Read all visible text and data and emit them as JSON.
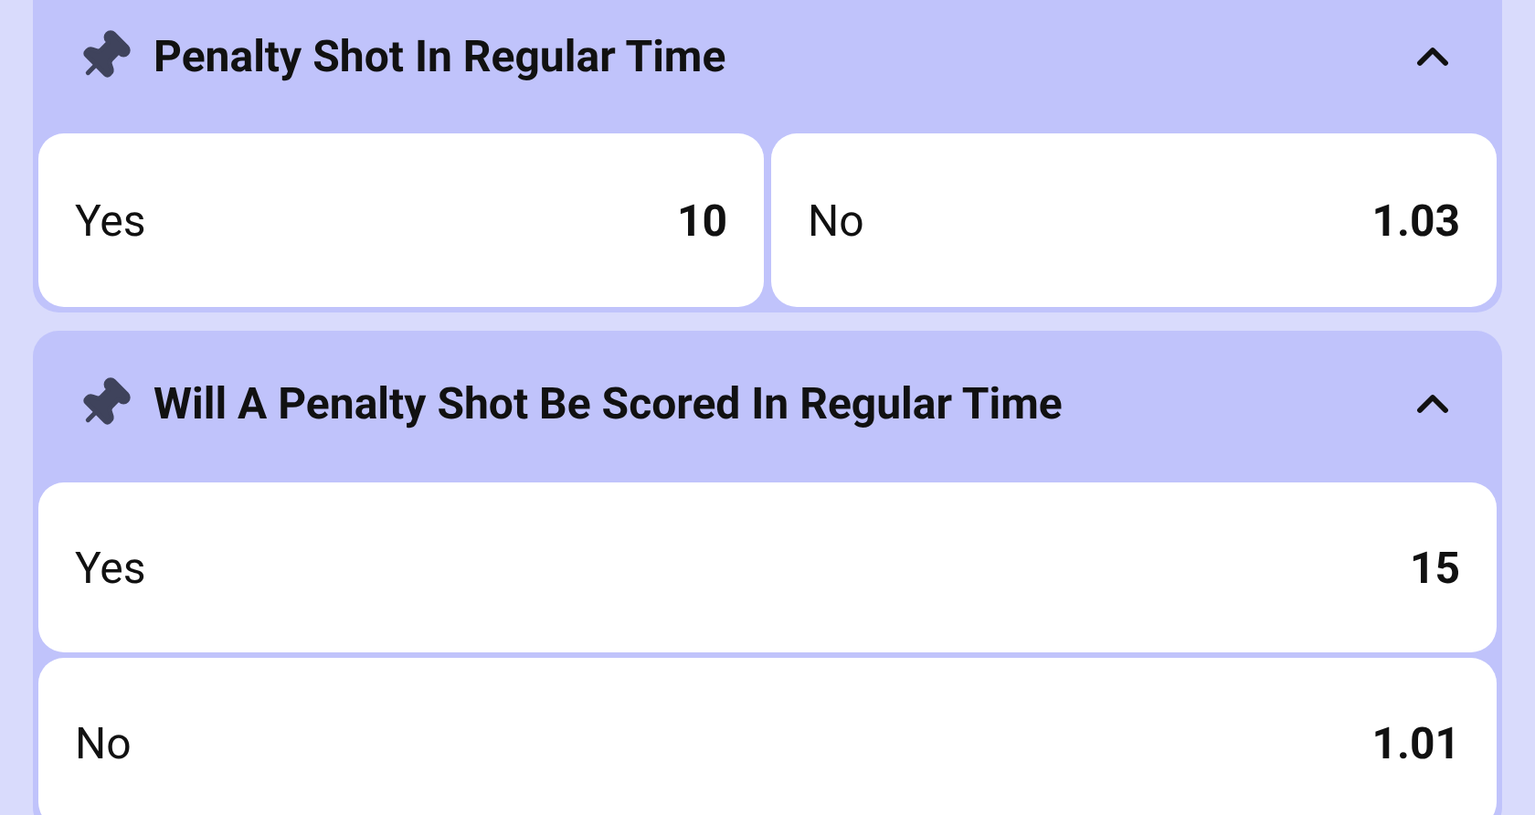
{
  "markets": [
    {
      "title": "Penalty Shot In Regular Time",
      "expanded": true,
      "kind": "columns",
      "options": [
        {
          "label": "Yes",
          "odds": "10"
        },
        {
          "label": "No",
          "odds": "1.03"
        }
      ]
    },
    {
      "title": "Will A Penalty Shot Be Scored In Regular Time",
      "expanded": true,
      "kind": "rows",
      "options": [
        {
          "label": "Yes",
          "odds": "15"
        },
        {
          "label": "No",
          "odds": "1.01"
        }
      ]
    }
  ]
}
